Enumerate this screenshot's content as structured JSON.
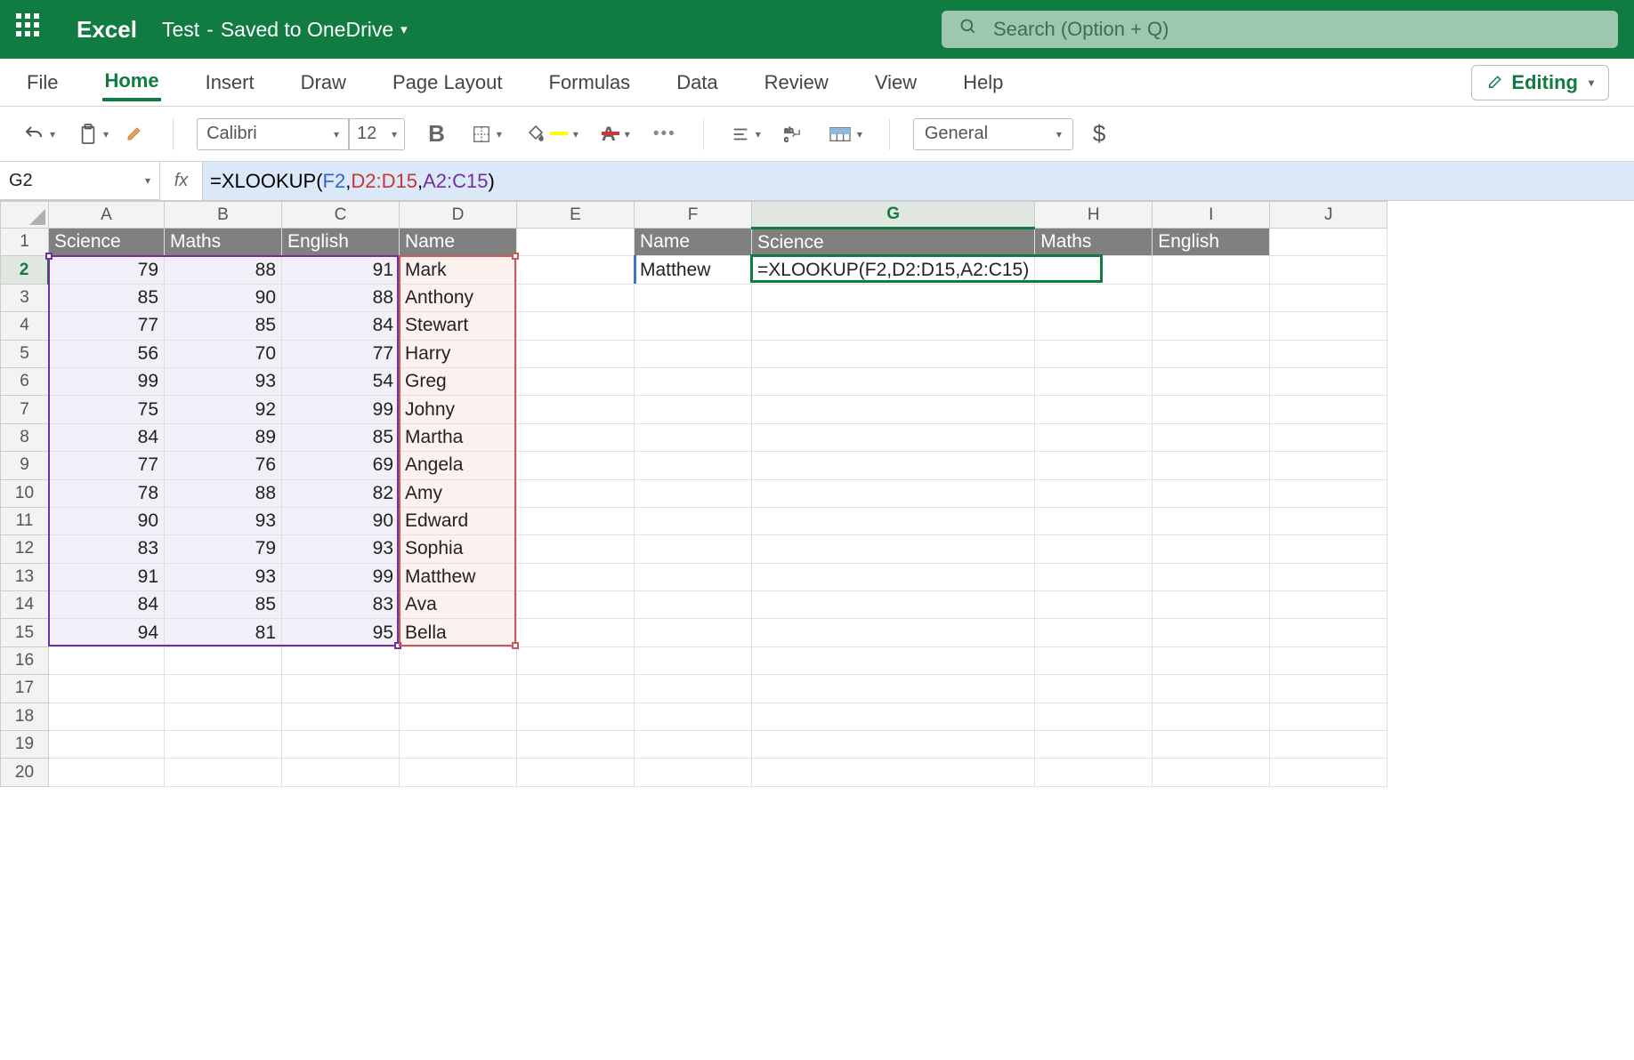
{
  "titlebar": {
    "app_name": "Excel",
    "doc_name": "Test",
    "saved_status": "Saved to OneDrive",
    "search_placeholder": "Search (Option + Q)"
  },
  "ribbon": {
    "tabs": [
      "File",
      "Home",
      "Insert",
      "Draw",
      "Page Layout",
      "Formulas",
      "Data",
      "Review",
      "View",
      "Help"
    ],
    "active_tab": "Home",
    "editing_label": "Editing",
    "font_name": "Calibri",
    "font_size": "12",
    "number_format": "General"
  },
  "formula_bar": {
    "name_box": "G2",
    "formula_prefix": "=XLOOKUP(",
    "arg1": "F2",
    "arg2": "D2:D15",
    "arg3": "A2:C15",
    "formula_suffix": ")"
  },
  "grid": {
    "columns": [
      "A",
      "B",
      "C",
      "D",
      "E",
      "F",
      "G",
      "H",
      "I",
      "J"
    ],
    "active_col": "G",
    "active_row": 2,
    "headers_left": {
      "A": "Science",
      "B": "Maths",
      "C": "English",
      "D": "Name"
    },
    "headers_right": {
      "F": "Name",
      "G": "Science",
      "H": "Maths",
      "I": "English"
    },
    "data": [
      {
        "A": 79,
        "B": 88,
        "C": 91,
        "D": "Mark"
      },
      {
        "A": 85,
        "B": 90,
        "C": 88,
        "D": "Anthony"
      },
      {
        "A": 77,
        "B": 85,
        "C": 84,
        "D": "Stewart"
      },
      {
        "A": 56,
        "B": 70,
        "C": 77,
        "D": "Harry"
      },
      {
        "A": 99,
        "B": 93,
        "C": 54,
        "D": "Greg"
      },
      {
        "A": 75,
        "B": 92,
        "C": 99,
        "D": "Johny"
      },
      {
        "A": 84,
        "B": 89,
        "C": 85,
        "D": "Martha"
      },
      {
        "A": 77,
        "B": 76,
        "C": 69,
        "D": "Angela"
      },
      {
        "A": 78,
        "B": 88,
        "C": 82,
        "D": "Amy"
      },
      {
        "A": 90,
        "B": 93,
        "C": 90,
        "D": "Edward"
      },
      {
        "A": 83,
        "B": 79,
        "C": 93,
        "D": "Sophia"
      },
      {
        "A": 91,
        "B": 93,
        "C": 99,
        "D": "Matthew"
      },
      {
        "A": 84,
        "B": 85,
        "C": 83,
        "D": "Ava"
      },
      {
        "A": 94,
        "B": 81,
        "C": 95,
        "D": "Bella"
      }
    ],
    "lookup_name": "Matthew",
    "cell_formula": "=XLOOKUP(F2,D2:D15,A2:C15)",
    "empty_rows_below": 5
  }
}
